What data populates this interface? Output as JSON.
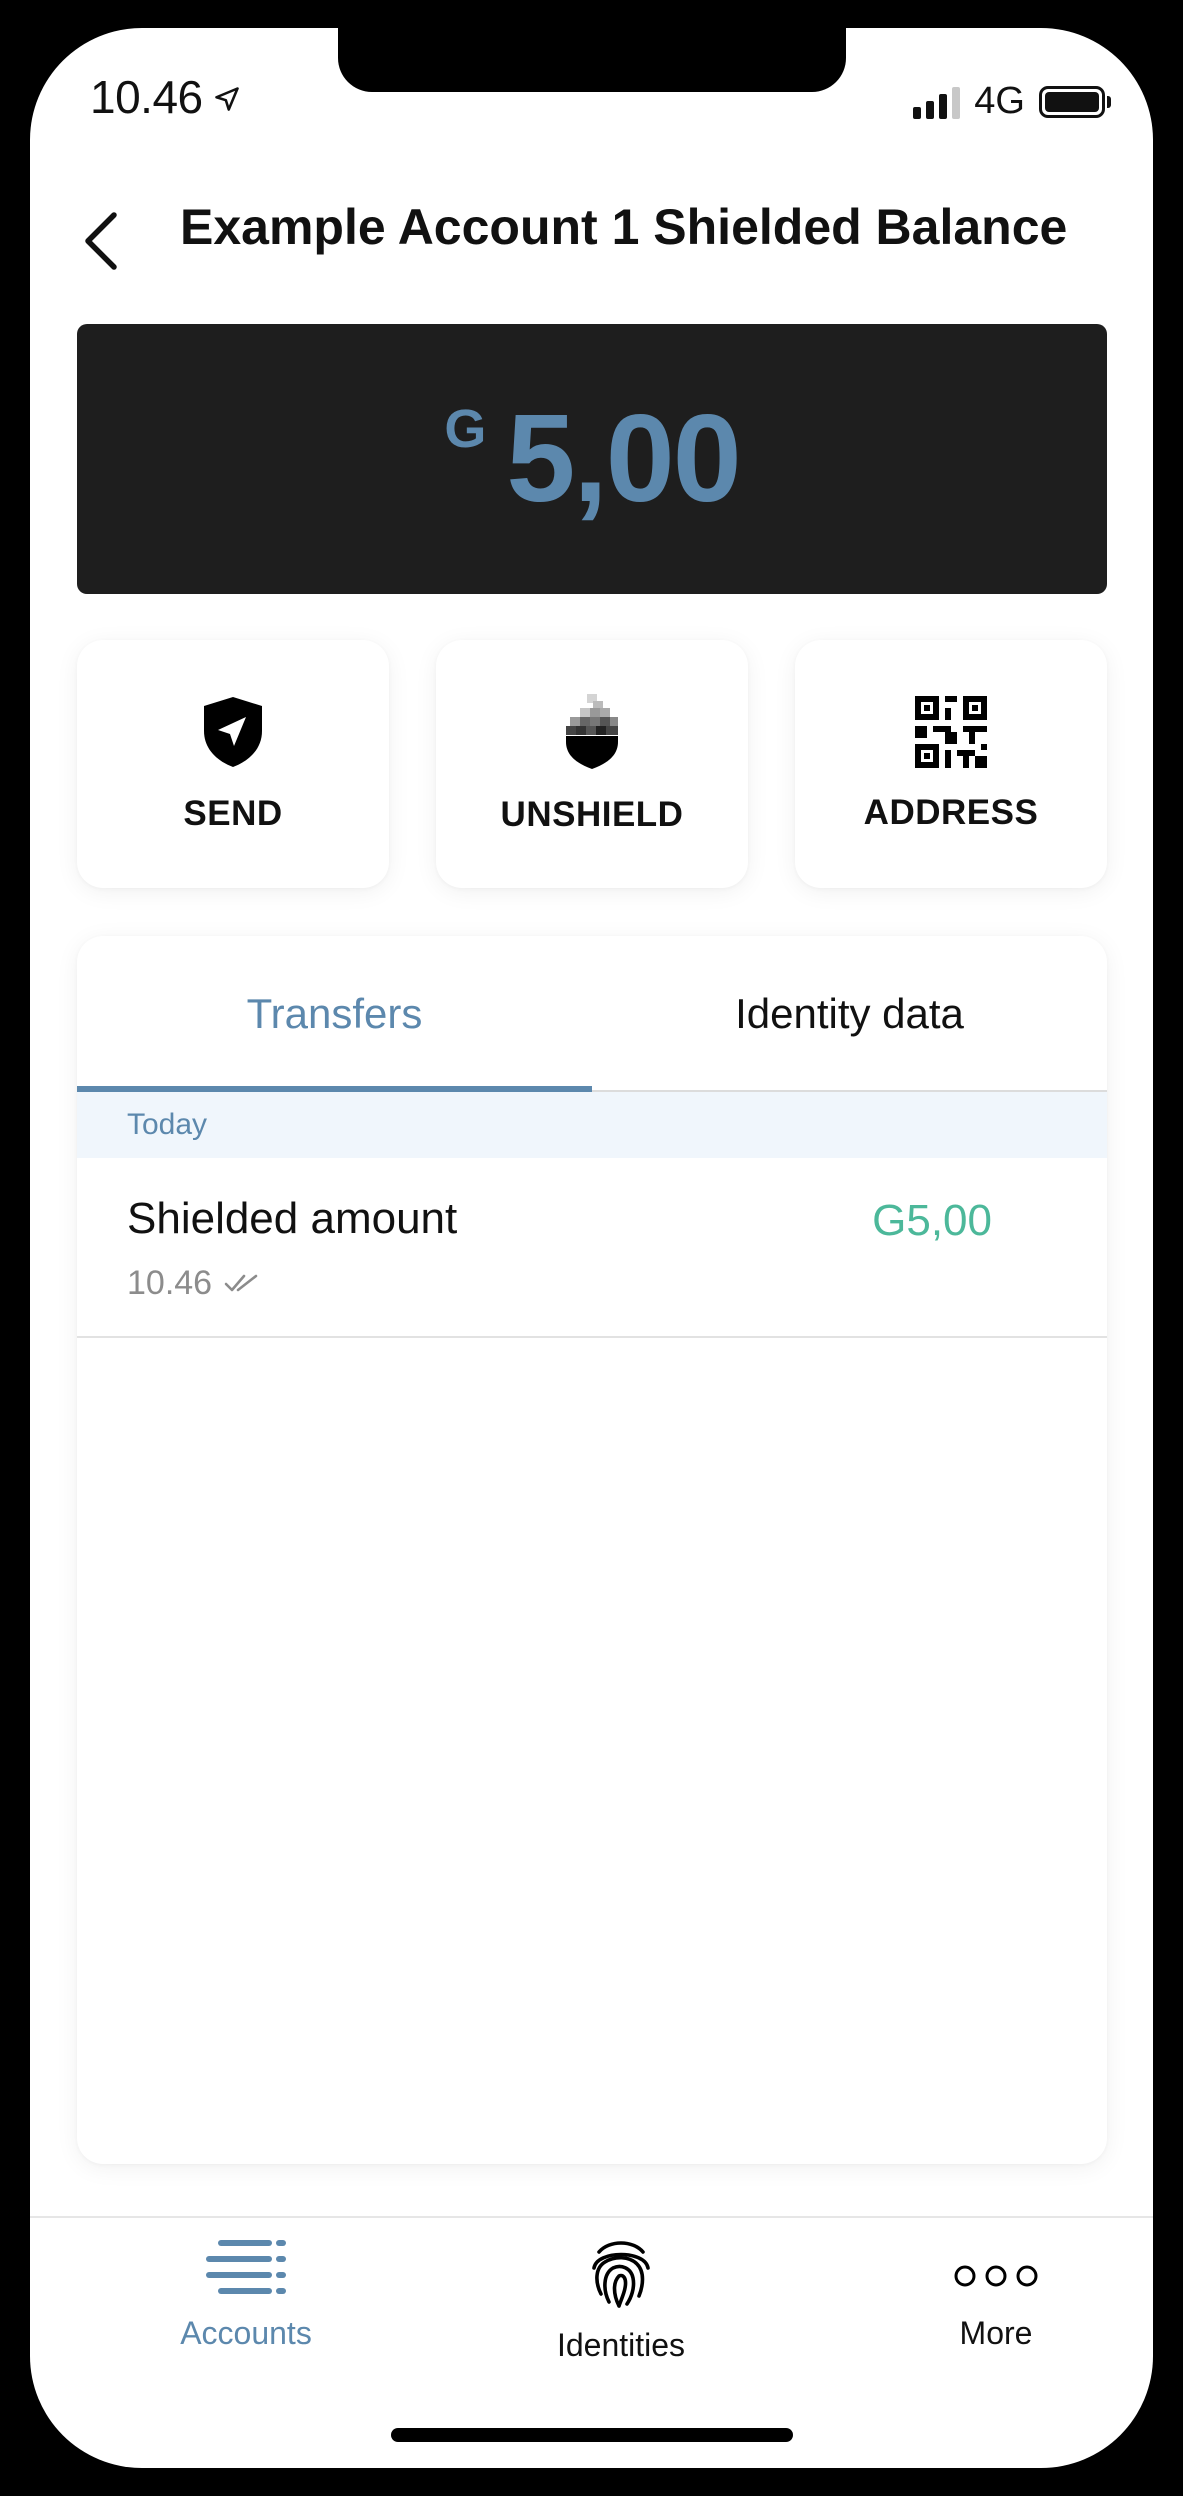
{
  "status_bar": {
    "time": "10.46",
    "network": "4G"
  },
  "header": {
    "title": "Example Account 1 Shielded Balance"
  },
  "balance": {
    "currency_symbol": "G",
    "amount": "5,00"
  },
  "actions": [
    {
      "label": "SEND",
      "icon": "shield-send-icon"
    },
    {
      "label": "UNSHIELD",
      "icon": "unshield-icon"
    },
    {
      "label": "ADDRESS",
      "icon": "qr-code-icon"
    }
  ],
  "tabs": [
    {
      "label": "Transfers",
      "active": true
    },
    {
      "label": "Identity data",
      "active": false
    }
  ],
  "transfers": {
    "section_label": "Today",
    "items": [
      {
        "title": "Shielded amount",
        "time": "10.46",
        "amount": "G5,00",
        "status_icon": "double-check-icon"
      }
    ]
  },
  "bottom_nav": [
    {
      "label": "Accounts",
      "icon": "accounts-list-icon",
      "active": true
    },
    {
      "label": "Identities",
      "icon": "fingerprint-icon",
      "active": false
    },
    {
      "label": "More",
      "icon": "more-dots-icon",
      "active": false
    }
  ],
  "colors": {
    "accent": "#5c88ad",
    "positive": "#4cb89a",
    "balance_card": "#1e1e1e",
    "section_header_bg": "#f0f6fc"
  }
}
